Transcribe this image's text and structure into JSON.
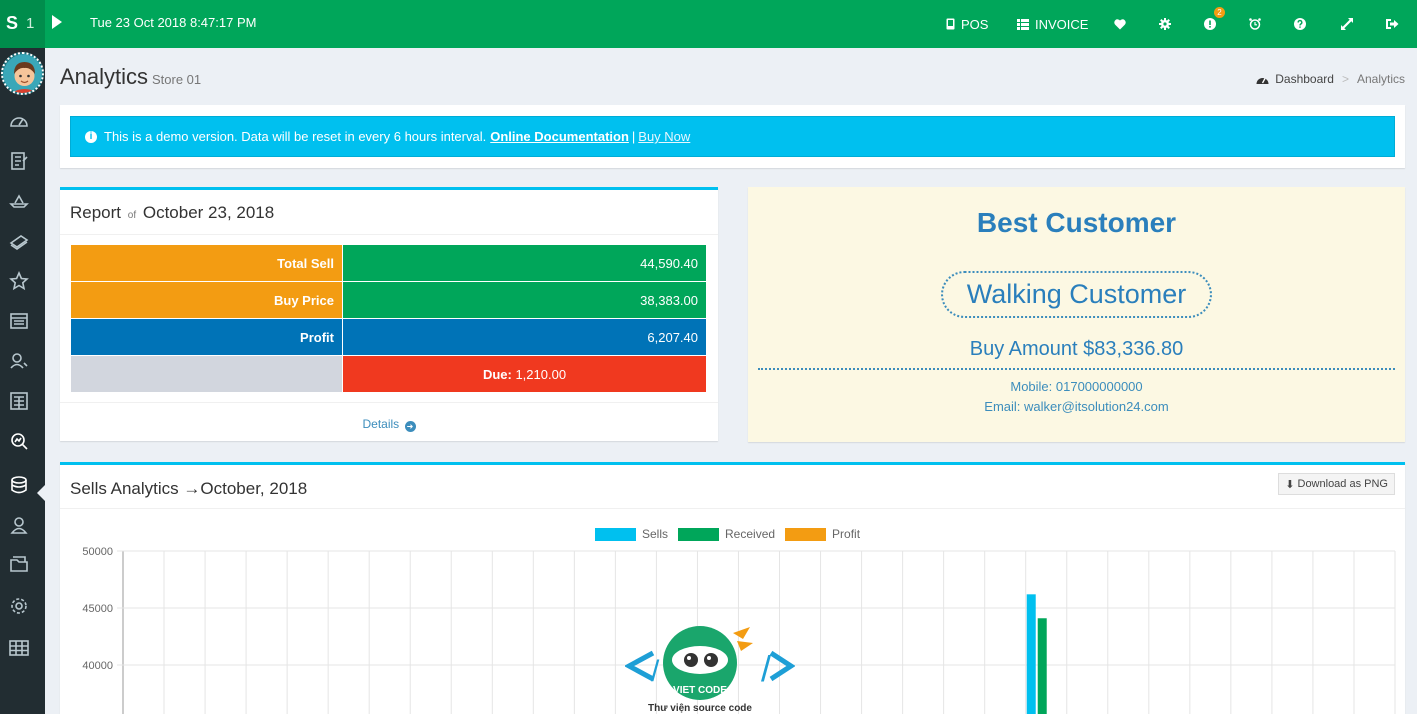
{
  "topbar": {
    "logo_letter": "S",
    "logo_number": "1",
    "datetime": "Tue 23 Oct 2018 8:47:17 PM",
    "pos_label": "POS",
    "invoice_label": "INVOICE",
    "notification_count": "2"
  },
  "header": {
    "title": "Analytics",
    "subtitle": "Store 01",
    "breadcrumb_home": "Dashboard",
    "breadcrumb_separator": ">",
    "breadcrumb_current": "Analytics"
  },
  "alert": {
    "message": "This is a demo version. Data will be reset in every 6 hours interval.",
    "doc_link": "Online Documentation",
    "separator": "|",
    "buy_link": "Buy Now"
  },
  "report": {
    "title_prefix": "Report",
    "title_of": "of",
    "title_date": "October 23, 2018",
    "rows": [
      {
        "label": "Total Sell",
        "value": "44,590.40"
      },
      {
        "label": "Buy Price",
        "value": "38,383.00"
      },
      {
        "label": "Profit",
        "value": "6,207.40"
      }
    ],
    "due_label": "Due:",
    "due_value": "1,210.00",
    "details_label": "Details"
  },
  "best_customer": {
    "title": "Best Customer",
    "name": "Walking Customer",
    "amount": "Buy Amount $83,336.80",
    "mobile": "Mobile: 017000000000",
    "email": "Email: walker@itsolution24.com"
  },
  "sells_analytics": {
    "title": "Sells Analytics →October, 2018",
    "download_label": "Download as PNG"
  },
  "watermark": {
    "caption": "Thư viện source code",
    "badge_text": "VIET CODE"
  },
  "chart_data": {
    "type": "bar",
    "series": [
      {
        "name": "Sells",
        "color": "#00c0ef"
      },
      {
        "name": "Received",
        "color": "#00a65a"
      },
      {
        "name": "Profit",
        "color": "#f39c12"
      }
    ],
    "y_ticks": [
      "50000",
      "45000",
      "40000"
    ],
    "ylim": [
      35000,
      50000
    ],
    "x_days": 31,
    "bars": [
      {
        "day": 23,
        "series": "Sells",
        "value": 46200
      },
      {
        "day": 23,
        "series": "Received",
        "value": 44100
      }
    ],
    "grid": true,
    "legend": "top-center"
  },
  "colors": {
    "topbar": "#00a65a",
    "sidebar": "#222d32",
    "accent": "#00c0ef"
  },
  "icons": {
    "pos": "mobile-icon",
    "invoice": "list-icon",
    "favorite": "heart-icon",
    "settings": "gear-icon",
    "alert": "exclamation-icon",
    "alarm": "alarm-clock-icon",
    "help": "question-icon",
    "fullscreen": "expand-icon",
    "logout": "sign-out-icon"
  }
}
